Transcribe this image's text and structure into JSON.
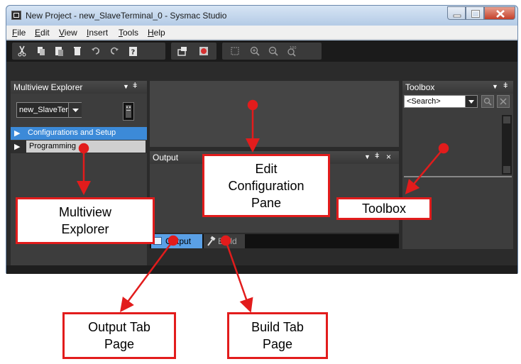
{
  "window": {
    "title": "New Project - new_SlaveTerminal_0 - Sysmac Studio",
    "menu": [
      {
        "label": "File",
        "key": "F",
        "rest": "ile"
      },
      {
        "label": "Edit",
        "key": "E",
        "rest": "dit"
      },
      {
        "label": "View",
        "key": "V",
        "rest": "iew"
      },
      {
        "label": "Insert",
        "key": "I",
        "rest": "nsert"
      },
      {
        "label": "Tools",
        "key": "T",
        "rest": "ools"
      },
      {
        "label": "Help",
        "key": "H",
        "rest": "elp"
      }
    ],
    "toolbar_icons": [
      "cut-icon",
      "copy-icon",
      "paste-icon",
      "delete-icon",
      "undo-icon",
      "redo-icon",
      "help-icon",
      "transfer-icon",
      "error-icon",
      "fit-icon",
      "zoom-in-icon",
      "zoom-out-icon",
      "zoom-100-icon"
    ]
  },
  "explorer": {
    "header": "Multiview Explorer",
    "device_select": "new_SlaveTerm",
    "items": [
      "Configurations and Setup",
      "Programming"
    ]
  },
  "output": {
    "header": "Output",
    "tabs": [
      "Output",
      "Build"
    ]
  },
  "toolbox": {
    "header": "Toolbox",
    "search_placeholder": "<Search>"
  },
  "annotations": {
    "explorer": [
      "Multiview",
      "Explorer"
    ],
    "edit_pane": [
      "Edit",
      "Configuration",
      "Pane"
    ],
    "toolbox": [
      "Toolbox"
    ],
    "output_tab": [
      "Output Tab",
      "Page"
    ],
    "build_tab": [
      "Build Tab",
      "Page"
    ]
  },
  "colors": {
    "callout_red": "#e21c1c",
    "selected_blue": "#3c8ad8",
    "output_tab_blue": "#5aa0e6"
  }
}
